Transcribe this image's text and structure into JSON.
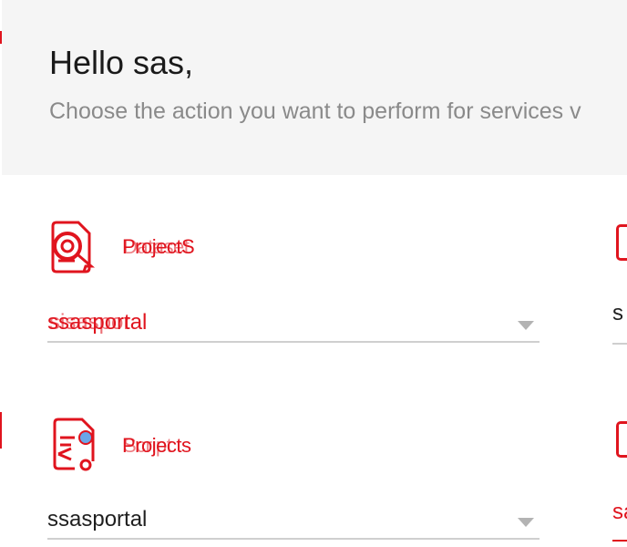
{
  "header": {
    "greeting": "Hello sas,",
    "subtitle": "Choose the action you want to perform for services v"
  },
  "cards": [
    {
      "title": "ProjectS",
      "title_overlap": "Dataset",
      "icon": "certificate-badge-icon",
      "select_value": "ssasportal",
      "select_value_overlap": "sisaspor"
    },
    {
      "title": "Projects",
      "title_overlap": "Script",
      "icon": "document-share-icon",
      "select_value": "ssasportal"
    }
  ],
  "right_column": {
    "row1_value": "s",
    "row2_value": "sa"
  },
  "colors": {
    "accent": "#e0141e",
    "header_bg": "#f5f5f5",
    "subtitle": "#8a8a8a",
    "divider": "#cfcfcf"
  }
}
